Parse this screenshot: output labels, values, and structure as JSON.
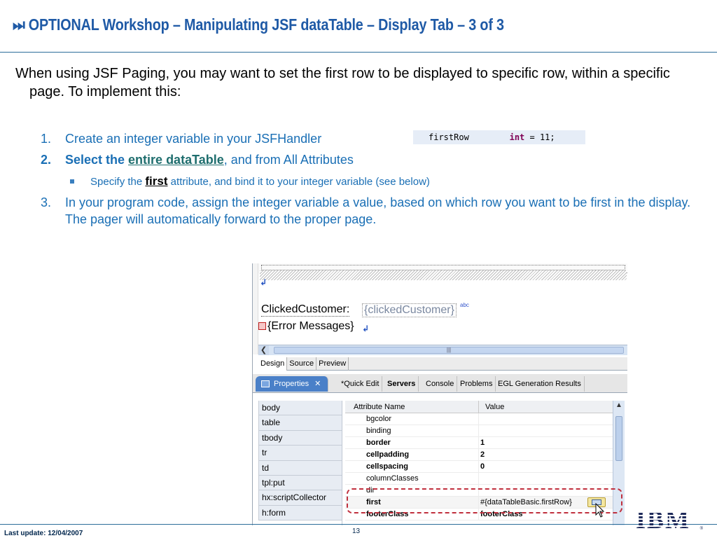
{
  "slide": {
    "title_icon": "⏭",
    "title": "OPTIONAL Workshop – Manipulating JSF dataTable – Display Tab – 3 of 3",
    "intro": "When using JSF Paging, you may want to set the first row to be displayed to specific row, within a specific page.  To implement this:",
    "items": [
      {
        "num": "1.",
        "text": "Create an integer variable in your JSFHandler"
      },
      {
        "num": "2.",
        "text_bold": "Select the ",
        "text_em": "entire dataTable",
        "text_rest": ", and from All Attributes"
      },
      {
        "num": "3.",
        "text": "In your program code, assign the integer variable a value, based on which row you want to be first in the display.  The pager will automatically forward to the proper page."
      }
    ],
    "sub_item": {
      "before": "Specify the ",
      "keyword": "first",
      "after": " attribute, and bind it to your integer variable (see below)"
    },
    "code": {
      "name": "firstRow",
      "gap": "        ",
      "type": "int",
      "rest": " = 11;"
    }
  },
  "design": {
    "clicked_label": "ClickedCustomer:",
    "clicked_value": "{clickedCustomer}",
    "abc": "abc",
    "errors": "{Error Messages}",
    "return_glyph": "↲",
    "scroll_left": "❮",
    "thumb_grip": "|||"
  },
  "editor_tabs": [
    "Design",
    "Source",
    "Preview"
  ],
  "views": {
    "properties": "Properties",
    "close": "✕",
    "tabs": [
      "*Quick Edit",
      "Servers",
      "Console",
      "Problems",
      "EGL Generation Results"
    ]
  },
  "tags": [
    "body",
    "table",
    "tbody",
    "tr",
    "td",
    "tpl:put",
    "hx:scriptCollector",
    "h:form"
  ],
  "attributes": {
    "header": [
      "Attribute Name",
      "Value"
    ],
    "rows": [
      {
        "name": "bgcolor",
        "value": ""
      },
      {
        "name": "binding",
        "value": ""
      },
      {
        "name": "border",
        "value": "1"
      },
      {
        "name": "cellpadding",
        "value": "2"
      },
      {
        "name": "cellspacing",
        "value": "0"
      },
      {
        "name": "columnClasses",
        "value": ""
      },
      {
        "name": "dir",
        "value": ""
      },
      {
        "name": "first",
        "value": "#{dataTableBasic.firstRow}"
      },
      {
        "name": "footerClass",
        "value": "footerClass"
      }
    ]
  },
  "scroll": {
    "up": "▲",
    "down": "▼"
  },
  "footer": {
    "last_update": "Last update: 12/04/2007",
    "page": "13",
    "logo": "IBM",
    "reg": "®"
  }
}
